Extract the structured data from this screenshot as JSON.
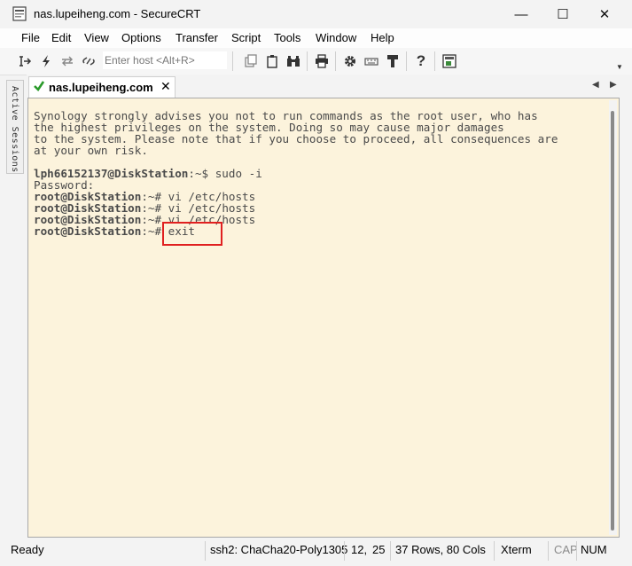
{
  "window": {
    "title": "nas.lupeiheng.com - SecureCRT",
    "minimize_glyph": "—",
    "maximize_glyph": "☐",
    "close_glyph": "✕"
  },
  "menu": [
    "File",
    "Edit",
    "View",
    "Options",
    "Transfer",
    "Script",
    "Tools",
    "Window",
    "Help"
  ],
  "toolbar": {
    "host_placeholder": "Enter host <Alt+R>",
    "icons": [
      "connect-icon",
      "quick-connect-icon",
      "reconnect-icon",
      "disconnect-icon",
      "copy-icon",
      "paste-icon",
      "find-icon",
      "print-icon",
      "settings-icon",
      "keymap-icon",
      "sftp-icon",
      "help-icon",
      "about-icon"
    ]
  },
  "sidebar": {
    "label": "Active Sessions"
  },
  "tab": {
    "label": "nas.lupeiheng.com",
    "close": "✕",
    "prev": "◀",
    "next": "▶"
  },
  "terminal": {
    "lines": [
      {
        "text": "Synology strongly advises you not to run commands as the root user, who has",
        "bold": ""
      },
      {
        "text": "the highest privileges on the system. Doing so may cause major damages",
        "bold": ""
      },
      {
        "text": "to the system. Please note that if you choose to proceed, all consequences are",
        "bold": ""
      },
      {
        "text": "at your own risk.",
        "bold": ""
      },
      {
        "text": "",
        "bold": ""
      },
      {
        "bold": "lph66152137@DiskStation",
        "text": ":~$ sudo -i"
      },
      {
        "text": "Password:",
        "bold": ""
      },
      {
        "bold": "root@DiskStation",
        "text": ":~# vi /etc/hosts"
      },
      {
        "bold": "root@DiskStation",
        "text": ":~# vi /etc/hosts"
      },
      {
        "bold": "root@DiskStation",
        "text": ":~# vi /etc/hosts"
      },
      {
        "bold": "root@DiskStation",
        "text": ":~# exit"
      }
    ],
    "colors": {
      "background": "#fcf3dc",
      "text": "#4a4a4a",
      "highlight": "#e02020"
    }
  },
  "status": {
    "ready": "Ready",
    "cipher": "ssh2: ChaCha20-Poly1305",
    "row": "12,",
    "col": "25",
    "size": "37 Rows, 80 Cols",
    "terminal_type": "Xterm",
    "cap": "CAP",
    "num": "NUM"
  }
}
